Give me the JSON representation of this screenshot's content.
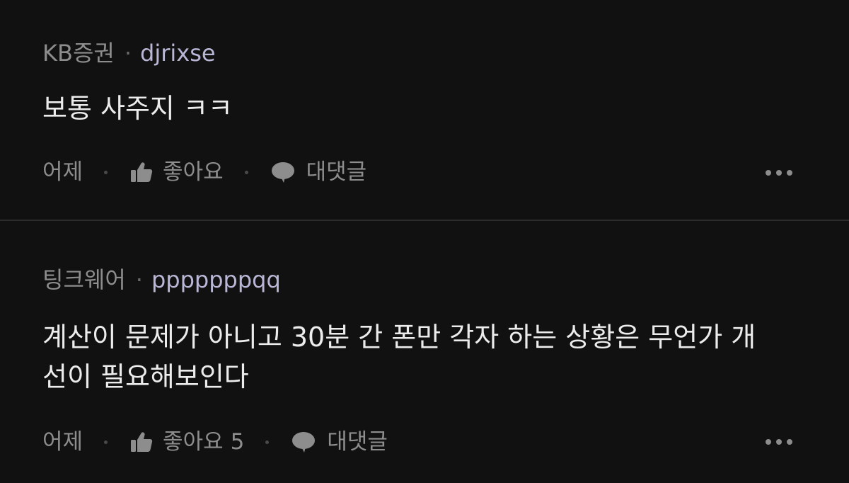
{
  "comments": [
    {
      "company": "KB증권",
      "separator": "·",
      "username": "djrixse",
      "text": "보통 사주지 ㅋㅋ",
      "time": "어제",
      "like_label": "좋아요",
      "like_count": "",
      "reply_label": "대댓글"
    },
    {
      "company": "팅크웨어",
      "separator": "·",
      "username": "pppppppqq",
      "text": "계산이 문제가 아니고 30분 간 폰만 각자 하는 상황은 무언가 개\n선이 필요해보인다",
      "time": "어제",
      "like_label": "좋아요",
      "like_count": "5",
      "reply_label": "대댓글"
    }
  ],
  "icons": {
    "like": "thumbs-up-icon",
    "reply": "speech-bubble-icon",
    "more": "more-horizontal-icon"
  },
  "colors": {
    "background": "#111111",
    "username": "#b9b7d6",
    "muted": "#8d8d8d",
    "text": "#ececec"
  }
}
